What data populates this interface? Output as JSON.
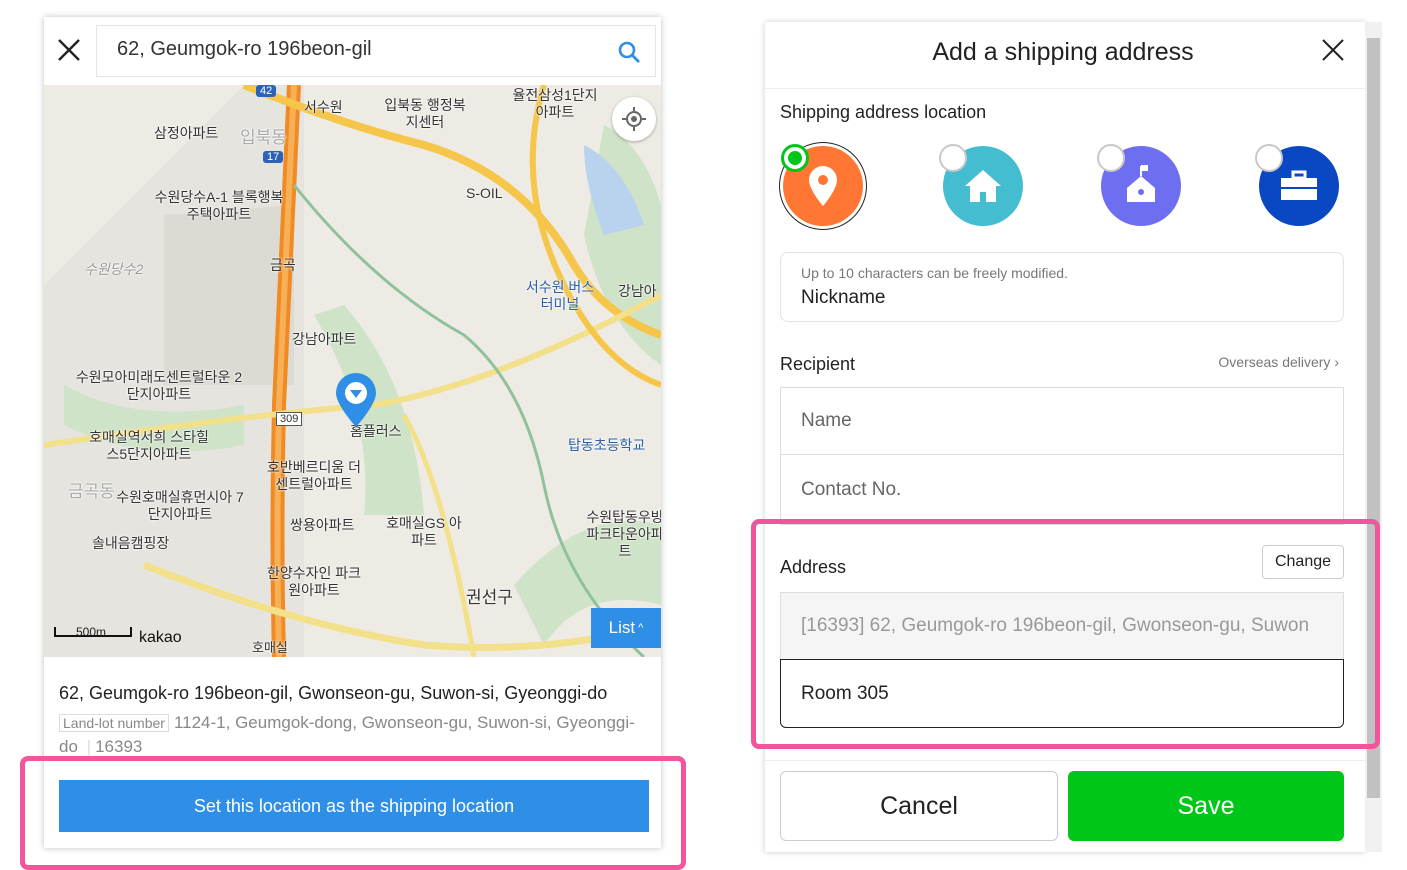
{
  "map_panel": {
    "search_value": "62, Geumgok-ro 196beon-gil",
    "map_labels": [
      "삼정아파트",
      "입북동",
      "서수원",
      "입북동 행정복지센터",
      "율전삼성1단지 아파트",
      "수원당수A-1 블록행복주택아파트",
      "수원당수2",
      "금곡",
      "S-OIL",
      "서수원 버스터미널",
      "강남아파트",
      "수원모아미래도센트럴타운 2단지아파트",
      "호매실역서희 스타힐스5단지아파트",
      "홈플러스",
      "탑동초등학교",
      "호반베르디움 더센트럴아파트",
      "수원호매실휴먼시아 7단지아파트",
      "쌍용아파트",
      "호매실GS 아파트",
      "솔내음캠핑장",
      "한양수자인 파크원아파트",
      "권선구",
      "수원탑동우방 파크타운아파트",
      "호매실",
      "금곡동",
      "강남아"
    ],
    "road_badges": [
      "42",
      "17",
      "309"
    ],
    "scale": "500m",
    "brand": "kakao",
    "list_button": "List",
    "address_main": "62, Geumgok-ro 196beon-gil, Gwonseon-gu, Suwon-si, Gyeonggi-do",
    "landlot_tag": "Land-lot number",
    "landlot_address": "1124-1, Geumgok-dong, Gwonseon-gu, Suwon-si, Gyeonggi-do",
    "postal_code": "16393",
    "set_button": "Set this location as the shipping location"
  },
  "dialog": {
    "title": "Add a shipping address",
    "location_label": "Shipping address location",
    "location_types": [
      {
        "icon": "map-pin-icon",
        "color": "#ff7733",
        "selected": true
      },
      {
        "icon": "home-icon",
        "color": "#44bdd0",
        "selected": false
      },
      {
        "icon": "school-icon",
        "color": "#6e6ef0",
        "selected": false
      },
      {
        "icon": "briefcase-icon",
        "color": "#0a47c2",
        "selected": false
      }
    ],
    "nickname_hint": "Up to 10 characters can be freely modified.",
    "nickname_value": "Nickname",
    "recipient_label": "Recipient",
    "overseas_link": "Overseas delivery",
    "name_placeholder": "Name",
    "contact_placeholder": "Contact No.",
    "address_label": "Address",
    "change_button": "Change",
    "address_value": "[16393] 62, Geumgok-ro 196beon-gil, Gwonseon-gu, Suwon",
    "detail_value": "Room 305",
    "cancel_button": "Cancel",
    "save_button": "Save",
    "save_color": "#00c619"
  }
}
